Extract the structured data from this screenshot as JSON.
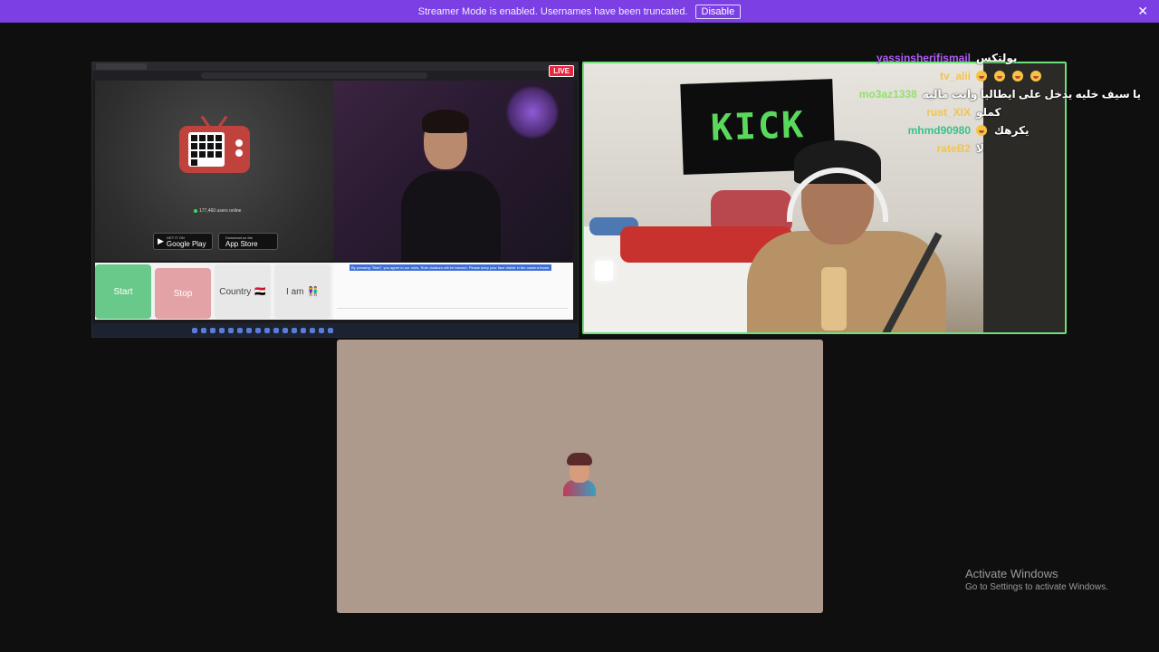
{
  "banner": {
    "message": "Streamer Mode is enabled. Usernames have been truncated.",
    "disable_label": "Disable",
    "close_glyph": "✕"
  },
  "screen_share": {
    "live_label": "LIVE",
    "users_online": "177,460 users online",
    "google_play": {
      "small": "GET IT ON",
      "big": "Google Play"
    },
    "app_store": {
      "small": "Download on the",
      "big": "App Store"
    },
    "controls": {
      "start": "Start",
      "stop": "Stop",
      "country": "Country",
      "country_flag": "🇪🇬",
      "i_am": "I am",
      "i_am_icon": "👫"
    },
    "chat_notice": "By pressing \"Start\", you agree to our rules, Rule violators will be banned. Please keep your face visible in the camera frame."
  },
  "webcam": {
    "flag_text": "KICK"
  },
  "chat": [
    {
      "user": "yassinsherifismail",
      "color": "#b15cf5",
      "msg": "بولتكس",
      "emotes": 0
    },
    {
      "user": "tv_alii",
      "color": "#f2c44e",
      "msg": "",
      "emotes": 4
    },
    {
      "user": "mo3az1338",
      "color": "#8fe36b",
      "msg": "يا سيف خليه يدخل على ايطاليا وانت ماليه",
      "emotes": 0
    },
    {
      "user": "rust_XIX",
      "color": "#f2c44e",
      "msg": "كملو",
      "emotes": 0
    },
    {
      "user": "mhmd90980",
      "color": "#39c28b",
      "msg": "يكرهك",
      "emotes": 1
    },
    {
      "user": "rateB2",
      "color": "#f2c44e",
      "msg": "لا",
      "emotes": 0
    }
  ],
  "watermark": {
    "title": "Activate Windows",
    "subtitle": "Go to Settings to activate Windows."
  }
}
